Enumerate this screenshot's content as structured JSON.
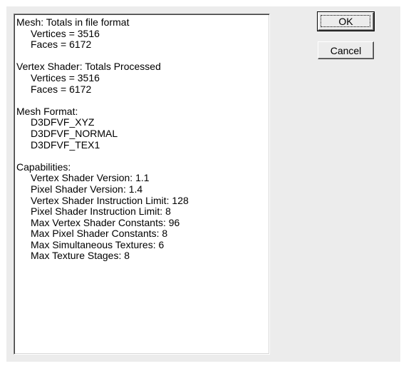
{
  "dialog": {
    "lines": [
      {
        "text": "Mesh: Totals in file format",
        "indent": false
      },
      {
        "text": "Vertices = 3516",
        "indent": true
      },
      {
        "text": "Faces = 6172",
        "indent": true
      },
      {
        "text": "",
        "indent": false
      },
      {
        "text": "Vertex Shader: Totals Processed",
        "indent": false
      },
      {
        "text": "Vertices = 3516",
        "indent": true
      },
      {
        "text": "Faces = 6172",
        "indent": true
      },
      {
        "text": "",
        "indent": false
      },
      {
        "text": "Mesh Format:",
        "indent": false
      },
      {
        "text": "D3DFVF_XYZ",
        "indent": true
      },
      {
        "text": "D3DFVF_NORMAL",
        "indent": true
      },
      {
        "text": "D3DFVF_TEX1",
        "indent": true
      },
      {
        "text": "",
        "indent": false
      },
      {
        "text": "Capabilities:",
        "indent": false
      },
      {
        "text": "Vertex Shader Version: 1.1",
        "indent": true
      },
      {
        "text": "Pixel Shader Version: 1.4",
        "indent": true
      },
      {
        "text": "Vertex Shader Instruction Limit: 128",
        "indent": true
      },
      {
        "text": "Pixel Shader Instruction Limit: 8",
        "indent": true
      },
      {
        "text": "Max Vertex Shader Constants: 96",
        "indent": true
      },
      {
        "text": "Max Pixel Shader Constants: 8",
        "indent": true
      },
      {
        "text": "Max Simultaneous Textures: 6",
        "indent": true
      },
      {
        "text": "Max Texture Stages: 8",
        "indent": true
      }
    ],
    "ok_label": "OK",
    "cancel_label": "Cancel"
  }
}
